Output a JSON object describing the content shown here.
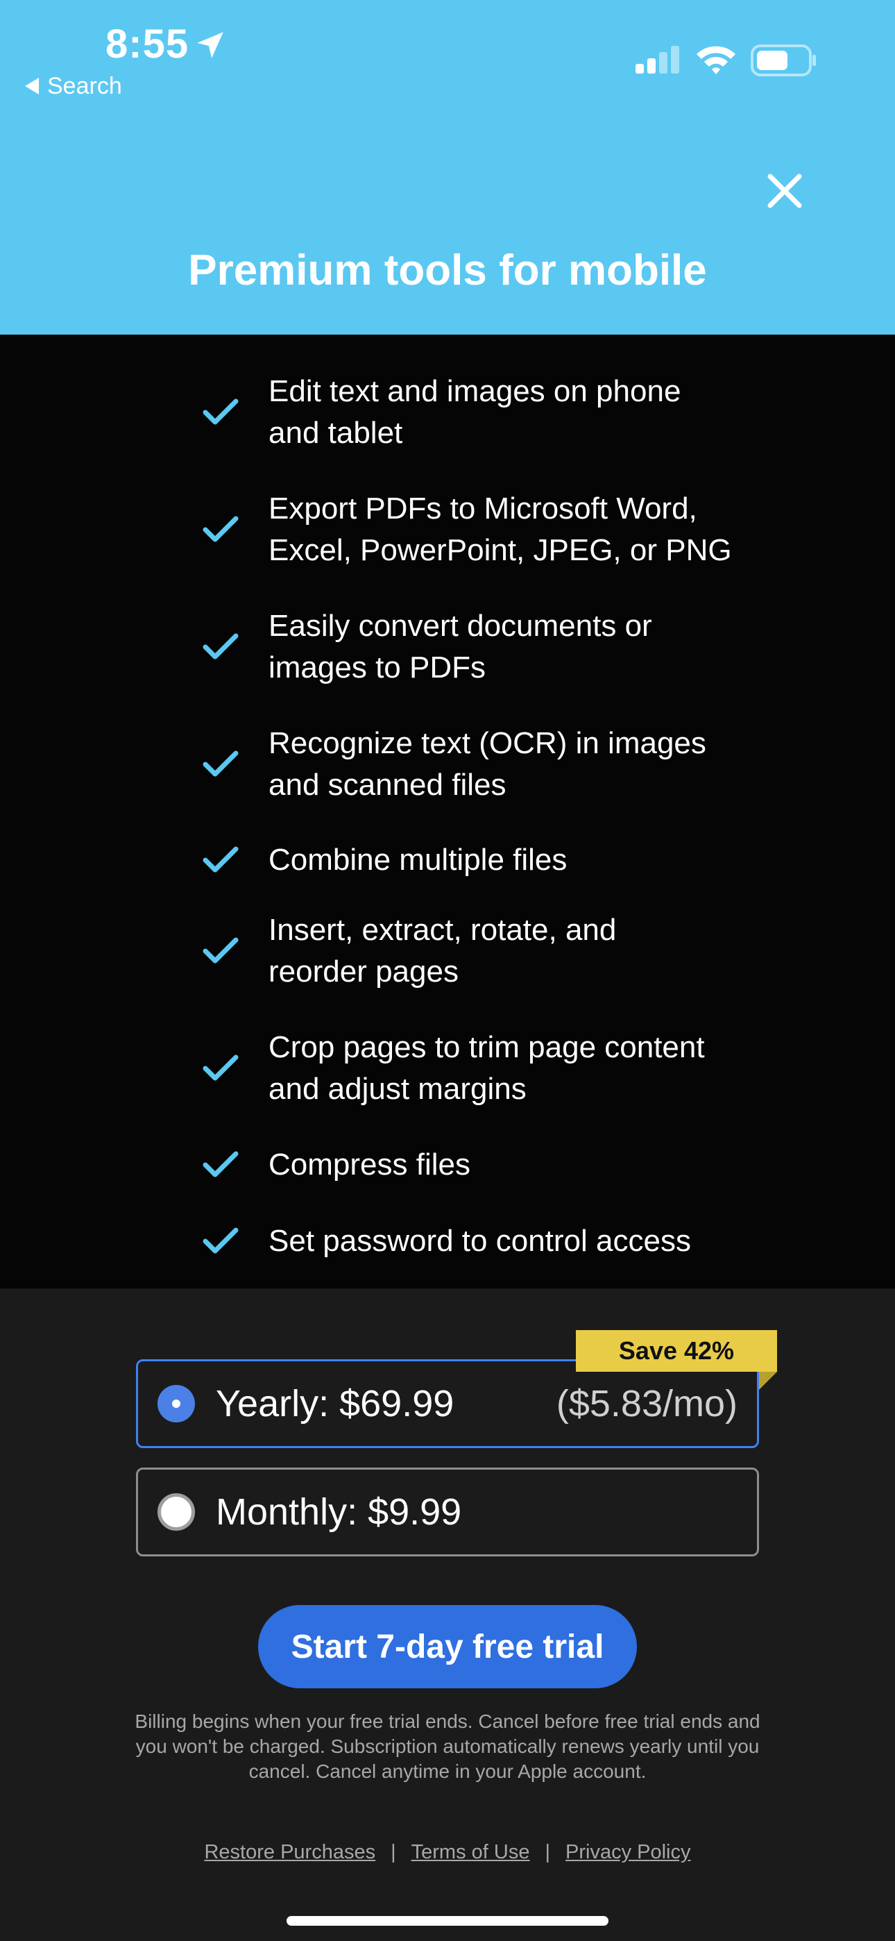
{
  "status_bar": {
    "time": "8:55",
    "back_label": "Search",
    "icons": [
      "location-arrow-icon",
      "cellular-signal-icon",
      "wifi-icon",
      "battery-icon"
    ]
  },
  "header": {
    "title": "Premium tools for mobile",
    "close_icon": "close-icon",
    "background_color": "#5bc8f2"
  },
  "features": [
    "Edit text and images on phone and tablet",
    "Export PDFs to Microsoft Word, Excel, PowerPoint, JPEG, or PNG",
    "Easily convert documents or images to PDFs",
    "Recognize text (OCR) in images and scanned files",
    "Combine multiple files",
    "Insert, extract, rotate, and reorder pages",
    "Crop pages to trim page content and adjust margins",
    "Compress files",
    "Set password to control access"
  ],
  "feature_lines": [
    [
      "Edit text and images on phone",
      "and tablet"
    ],
    [
      "Export PDFs to Microsoft Word,",
      "Excel, PowerPoint, JPEG, or PNG"
    ],
    [
      "Easily convert documents or",
      "images to PDFs"
    ],
    [
      "Recognize text (OCR) in images",
      "and scanned files"
    ],
    [
      "Combine multiple files"
    ],
    [
      "Insert, extract, rotate, and",
      "reorder pages"
    ],
    [
      "Crop pages to trim page content",
      "and adjust margins"
    ],
    [
      "Compress files"
    ],
    [
      "Set password to control access"
    ]
  ],
  "plans": {
    "badge": "Save 42%",
    "yearly": {
      "label": "Yearly: $69.99",
      "per_month": "($5.83/mo)",
      "selected": true
    },
    "monthly": {
      "label": "Monthly: $9.99",
      "selected": false
    }
  },
  "cta": {
    "label": "Start 7-day free trial"
  },
  "disclaimer": "Billing begins when your free trial ends. Cancel before free trial ends and you won't be charged. Subscription automatically renews yearly until you cancel. Cancel anytime in your Apple account.",
  "footer": {
    "restore": "Restore Purchases",
    "separator": "|",
    "terms": "Terms of Use",
    "privacy": "Privacy Policy"
  },
  "colors": {
    "accent": "#5bc8f2",
    "primary_button": "#2f6fe0",
    "badge": "#e8cc48",
    "features_bg": "#050505",
    "pricing_bg": "#1b1b1b"
  }
}
